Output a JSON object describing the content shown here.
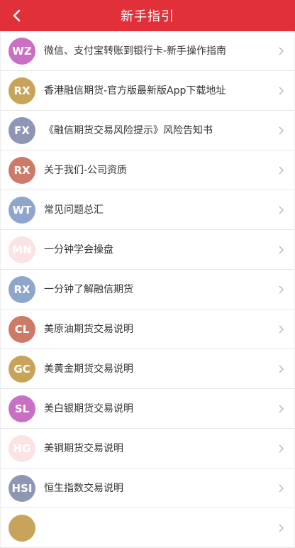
{
  "header": {
    "title": "新手指引",
    "background": "#e2303a"
  },
  "items": [
    {
      "initials": "WZ",
      "color": "#c96fc4",
      "label": "微信、支付宝转账到银行卡-新手操作指南"
    },
    {
      "initials": "RX",
      "color": "#c8a45a",
      "label": "香港融信期货-官方版最新版App下载地址"
    },
    {
      "initials": "FX",
      "color": "#8e96b4",
      "label": "《融信期货交易风险提示》风险告知书"
    },
    {
      "initials": "RX",
      "color": "#cd7a68",
      "label": "关于我们-公司资质"
    },
    {
      "initials": "WT",
      "color": "#8fa6cc",
      "label": "常见问题总汇"
    },
    {
      "initials": "MN",
      "color": "#fbe3e3",
      "label": "一分钟学会操盘"
    },
    {
      "initials": "RX",
      "color": "#8fa6cc",
      "label": "一分钟了解融信期货"
    },
    {
      "initials": "CL",
      "color": "#cd7a68",
      "label": "美原油期货交易说明"
    },
    {
      "initials": "GC",
      "color": "#c8a45a",
      "label": "美黄金期货交易说明"
    },
    {
      "initials": "SL",
      "color": "#c96fc4",
      "label": "美白银期货交易说明"
    },
    {
      "initials": "HG",
      "color": "#fbe3e3",
      "label": "美铜期货交易说明"
    },
    {
      "initials": "HSI",
      "color": "#8e96b4",
      "label": "恒生指数交易说明"
    },
    {
      "initials": "",
      "color": "#c8a45a",
      "label": ""
    }
  ]
}
